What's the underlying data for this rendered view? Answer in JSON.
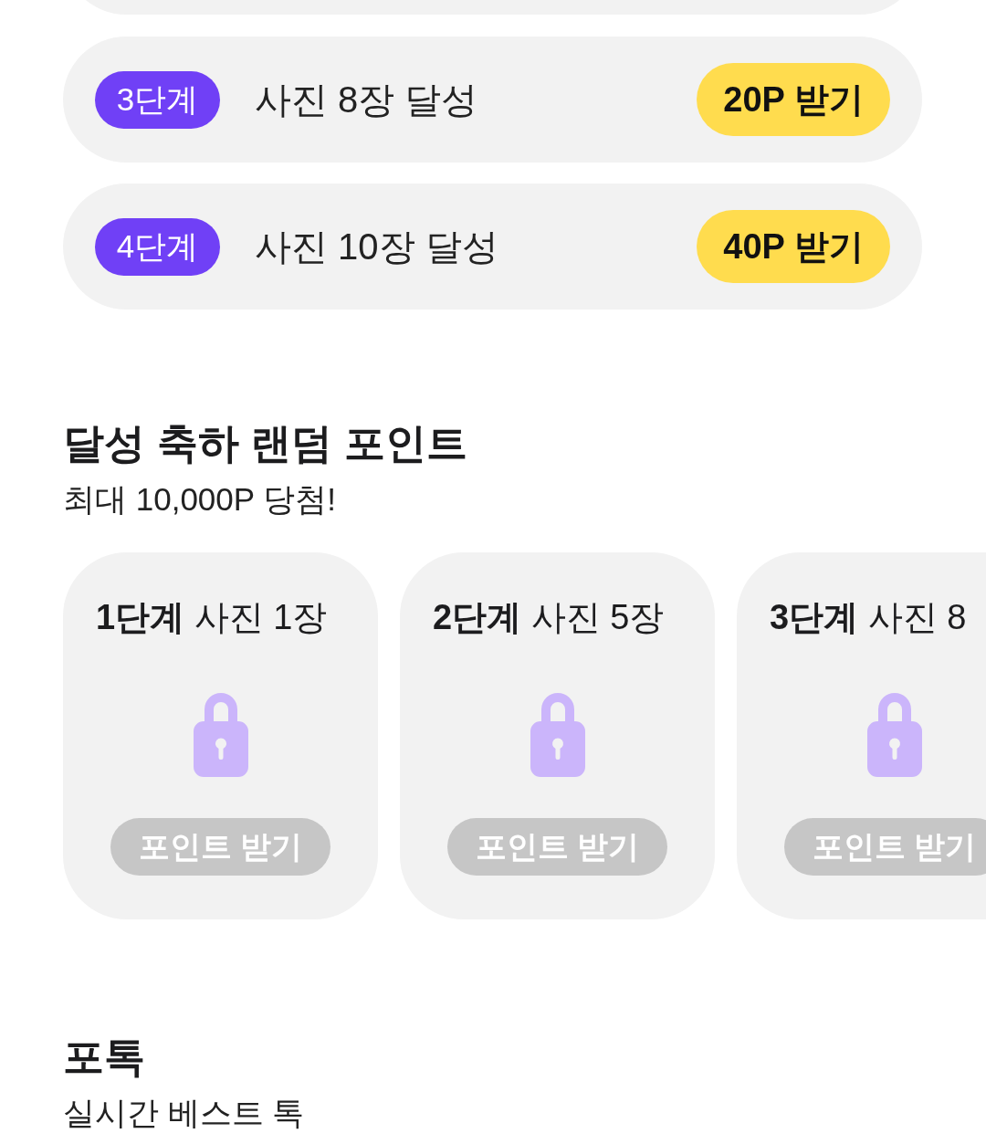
{
  "missions": [
    {
      "stage": "3단계",
      "text": "사진 8장 달성",
      "button": "20P 받기"
    },
    {
      "stage": "4단계",
      "text": "사진 10장 달성",
      "button": "40P 받기"
    }
  ],
  "reward_section": {
    "title": "달성 축하 랜덤 포인트",
    "subtitle": "최대 10,000P 당첨!",
    "cards": [
      {
        "title": "**1단계** 사진 1장",
        "locked": true,
        "button": "포인트 받기"
      },
      {
        "title": "**2단계** 사진 5장",
        "locked": true,
        "button": "포인트 받기"
      },
      {
        "title": "**3단계** 사진 8",
        "locked": true,
        "button": "포인트 받기"
      }
    ]
  },
  "photok_section": {
    "title": "포톡",
    "subtitle": "실시간 베스트 톡"
  }
}
